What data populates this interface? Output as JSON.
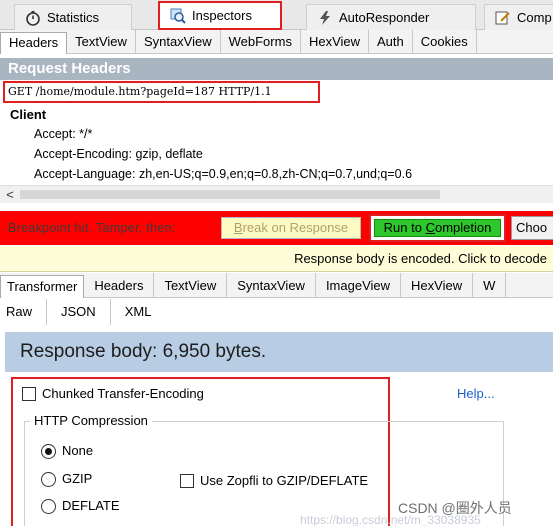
{
  "top_tabs": {
    "statistics": "Statistics",
    "inspectors": "Inspectors",
    "autoresponder": "AutoResponder",
    "composer": "Comp"
  },
  "request_tabs": [
    "Headers",
    "TextView",
    "SyntaxView",
    "WebForms",
    "HexView",
    "Auth",
    "Cookies"
  ],
  "request": {
    "title": "Request Headers",
    "request_line": "GET /home/module.htm?pageId=187 HTTP/1.1",
    "group": "Client",
    "headers": [
      "Accept: */*",
      "Accept-Encoding: gzip, deflate",
      "Accept-Language: zh,en-US;q=0.9,en;q=0.8,zh-CN;q=0.7,und;q=0.6"
    ]
  },
  "breakpoint": {
    "message": "Breakpoint hit. Tamper, then:",
    "break_on_response": "Break on Response",
    "run_to_completion": "Run to Completion",
    "choose": "Choo"
  },
  "encoded_notice": "Response body is encoded. Click to decode",
  "response_tabs": [
    "Transformer",
    "Headers",
    "TextView",
    "SyntaxView",
    "ImageView",
    "HexView",
    "W"
  ],
  "format_tabs": [
    "Raw",
    "JSON",
    "XML"
  ],
  "response_body": "Response body: 6,950 bytes.",
  "transformer": {
    "chunked_label": "Chunked Transfer-Encoding",
    "chunked_checked": false,
    "help": "Help...",
    "compression_title": "HTTP Compression",
    "options": [
      "None",
      "GZIP",
      "DEFLATE"
    ],
    "selected": "None",
    "zopfli_label": "Use Zopfli to GZIP/DEFLATE",
    "zopfli_checked": false
  },
  "watermark": "CSDN @圈外人员",
  "faint_url": "https://blog.csdn.net/m_33038935"
}
